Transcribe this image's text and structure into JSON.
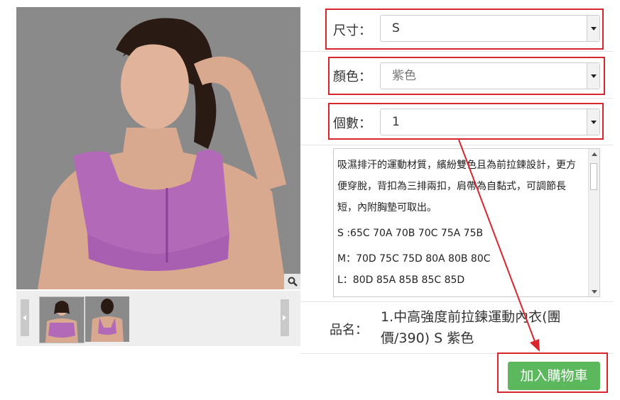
{
  "product": {
    "image_alt": "運動內衣 product photo",
    "thumbnails": [
      "front view thumbnail",
      "back view thumbnail"
    ]
  },
  "options": {
    "size": {
      "label": "尺寸：",
      "value": "S"
    },
    "color": {
      "label": "顏色：",
      "value": "紫色"
    },
    "quantity": {
      "label": "個數：",
      "value": "1"
    }
  },
  "description": {
    "line1": "吸濕排汗的運動材質，繽紛雙色且為前拉鍊設計，更方便穿脫，背扣為三排兩扣，肩帶為自黏式，可調節長短，內附胸墊可取出。",
    "sizes_s": "S :65C 70A 70B 70C 75A 75B",
    "sizes_m": "M：70D 75C 75D 80A 80B 80C",
    "sizes_l": "L：80D 85A 85B 85C 85D"
  },
  "summary": {
    "name_label": "品名：",
    "name_value": "1.中高強度前拉鍊運動內衣(團價/390) S 紫色"
  },
  "actions": {
    "add_to_cart": "加入購物車"
  },
  "colors": {
    "highlight": "#d9262e",
    "button": "#5cb85c",
    "arrow": "#d9262e"
  }
}
